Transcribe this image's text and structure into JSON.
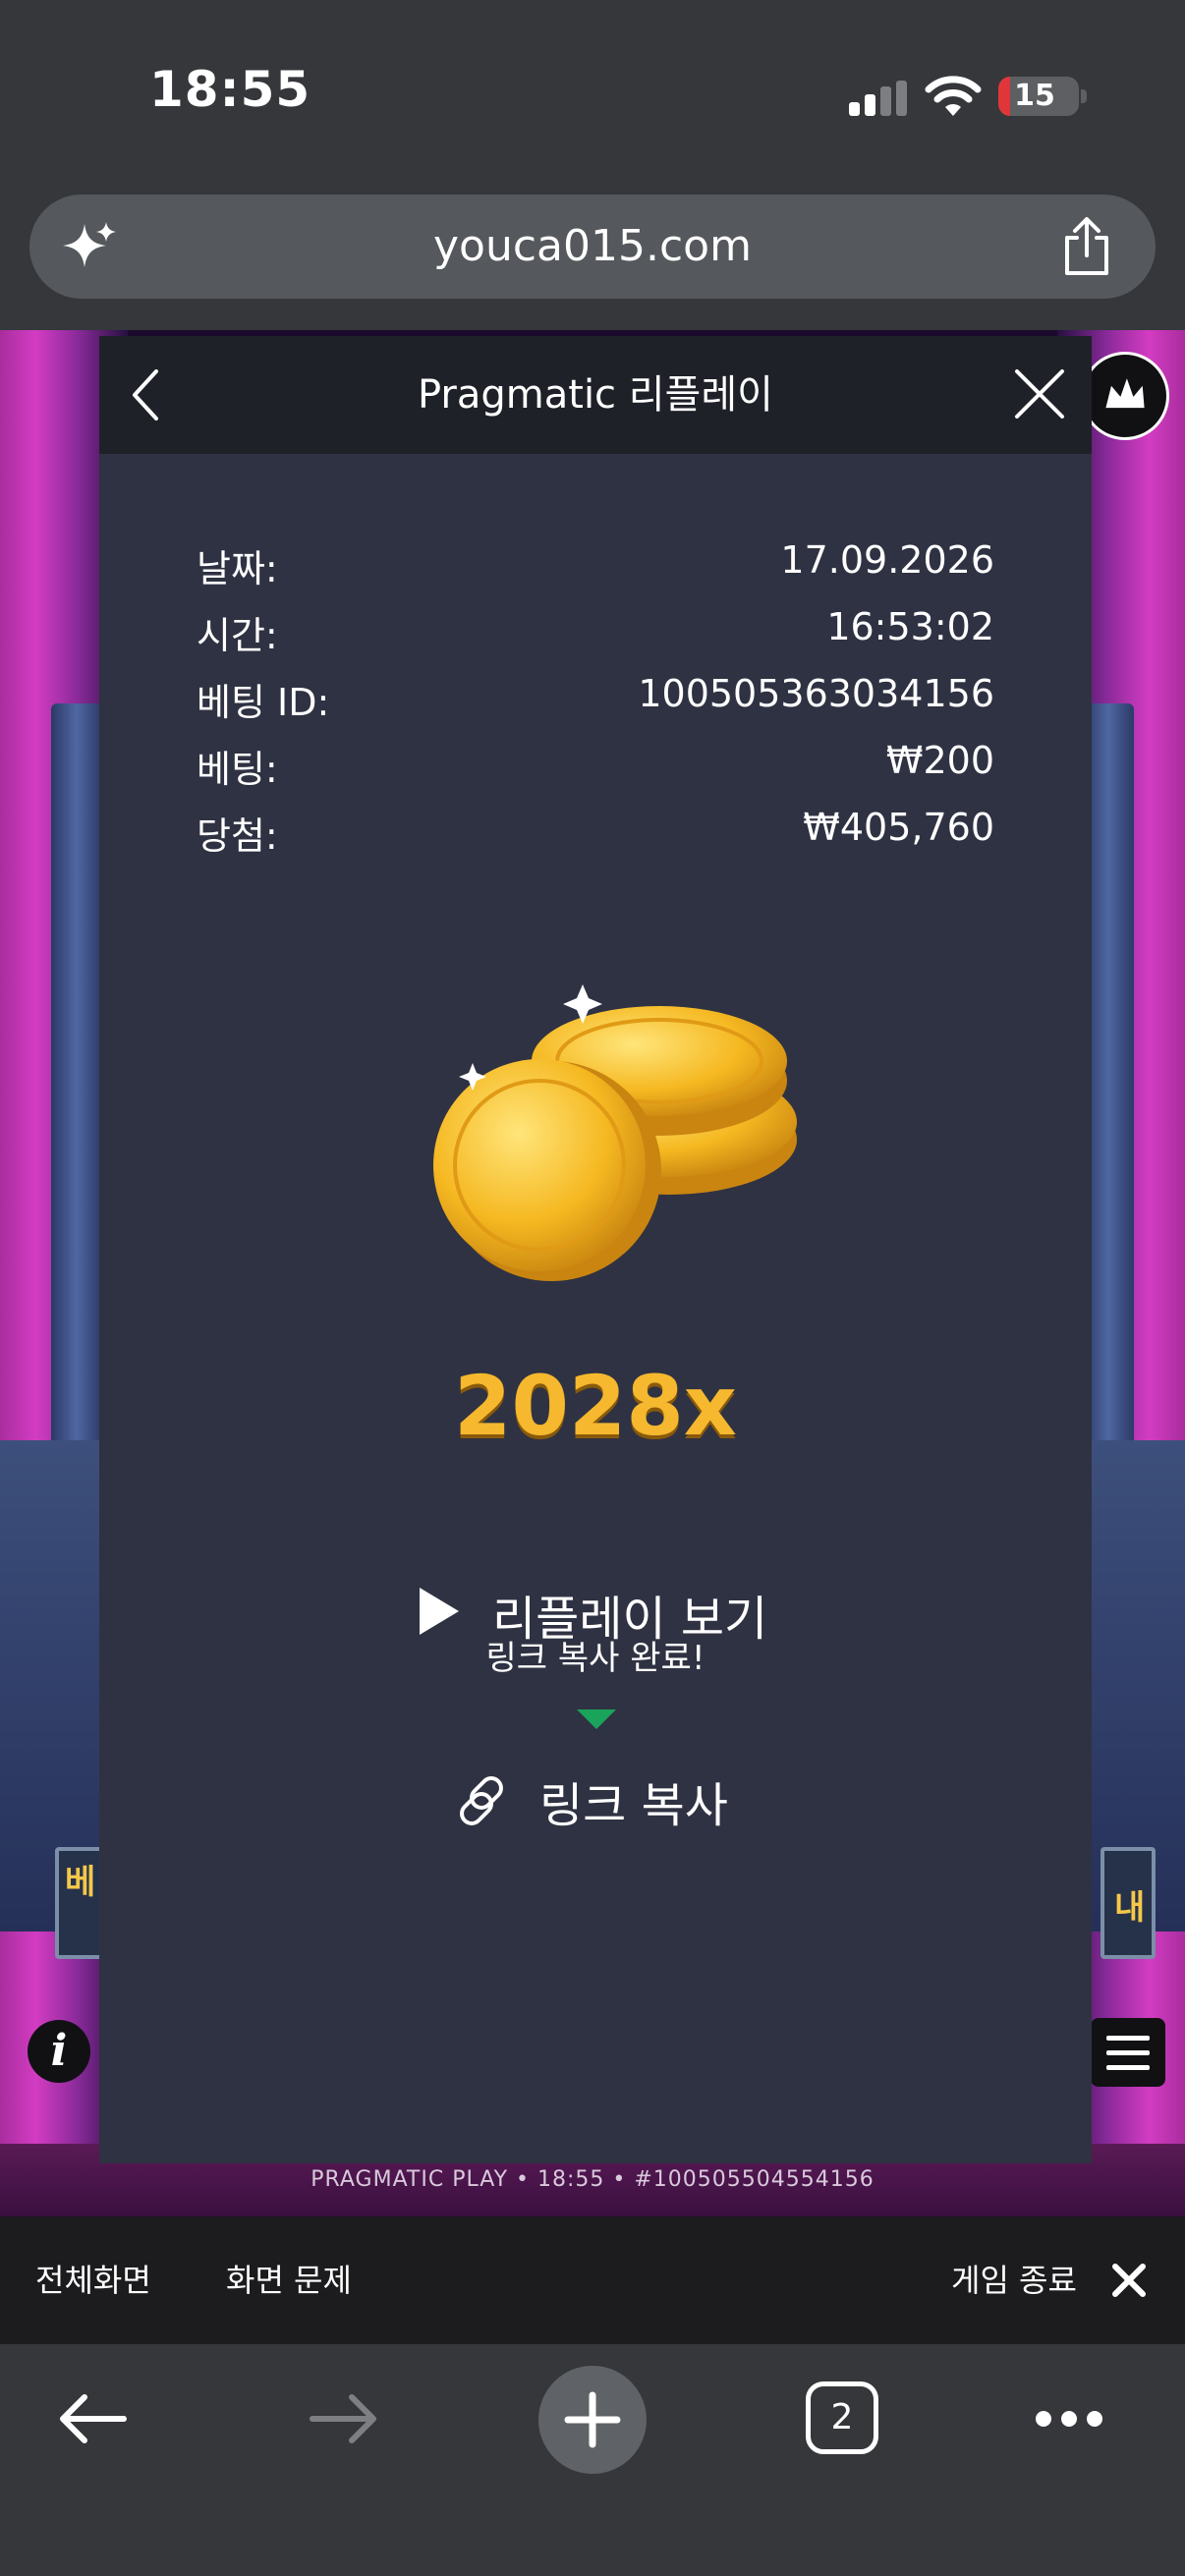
{
  "status_bar": {
    "time": "18:55",
    "battery_level": "15",
    "battery_color": "#e0363a",
    "icons": [
      "cellular-signal-icon",
      "wifi-icon",
      "battery-icon"
    ]
  },
  "address_bar": {
    "url": "youca015.com",
    "icons": [
      "sparkle-icon",
      "share-icon"
    ]
  },
  "game": {
    "bet_badge_left": "베",
    "bet_badge_right": "내",
    "info_label": "i",
    "footer_text": "PRAGMATIC PLAY • 18:55 • #100505504554156",
    "glow_color": "#d33cc2"
  },
  "modal": {
    "title": "Pragmatic 리플레이",
    "details": [
      {
        "label": "날짜:",
        "value": "17.09.2026"
      },
      {
        "label": "시간:",
        "value": "16:53:02"
      },
      {
        "label": "베팅 ID:",
        "value": "100505363034156"
      },
      {
        "label": "베팅:",
        "value": "₩200"
      },
      {
        "label": "당첨:",
        "value": "₩405,760"
      }
    ],
    "multiplier": "2028x",
    "replay_label": "리플레이 보기",
    "copied_tooltip": "링크 복사 완료!",
    "copy_link_label": "링크 복사",
    "accent_color": "#f5b82e",
    "tooltip_color": "#1aa35b"
  },
  "webview_bar": {
    "fullscreen_label": "전체화면",
    "screen_issue_label": "화면 문제",
    "exit_game_label": "게임 종료"
  },
  "toolbar": {
    "tab_count": "2",
    "icons": [
      "back-arrow-icon",
      "forward-arrow-icon",
      "plus-icon",
      "tabs-icon",
      "more-icon"
    ]
  }
}
